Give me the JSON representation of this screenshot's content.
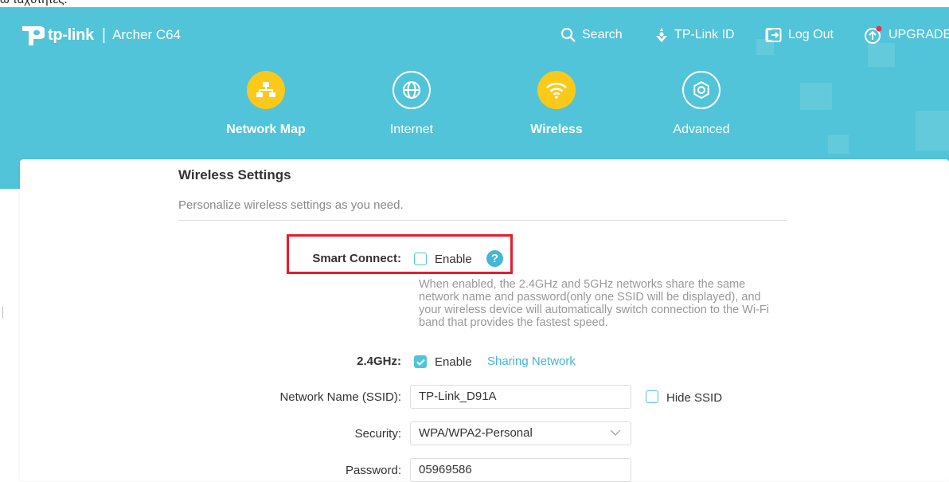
{
  "caption_text": "ώ ταχύτητες.",
  "brand": {
    "name": "tp-link",
    "model": "Archer C64"
  },
  "topnav": {
    "search": "Search",
    "tplink_id": "TP-Link ID",
    "logout": "Log Out",
    "upgrade": "UPGRADE"
  },
  "main_tabs": [
    {
      "label": "Network Map",
      "icon": "network-map-icon"
    },
    {
      "label": "Internet",
      "icon": "globe-icon"
    },
    {
      "label": "Wireless",
      "icon": "wifi-icon",
      "active": true
    },
    {
      "label": "Advanced",
      "icon": "advanced-gear-icon"
    }
  ],
  "page": {
    "title": "Wireless Settings",
    "subtitle": "Personalize wireless settings as you need."
  },
  "smart_connect": {
    "label": "Smart Connect:",
    "checkbox_label": "Enable",
    "checked": false,
    "help": "?",
    "description": "When enabled, the 2.4GHz and 5GHz networks share the same network name and password(only one SSID will be displayed), and your wireless device will automatically switch connection to the Wi-Fi band that provides the fastest speed."
  },
  "band_24": {
    "label": "2.4GHz:",
    "checkbox_label": "Enable",
    "checked": true,
    "sharing_link": "Sharing Network"
  },
  "ssid": {
    "label": "Network Name (SSID):",
    "value": "TP-Link_D91A",
    "hide_label": "Hide SSID",
    "hide_checked": false
  },
  "security": {
    "label": "Security:",
    "value": "WPA/WPA2-Personal"
  },
  "password": {
    "label": "Password:",
    "value": "05969586"
  },
  "colors": {
    "header": "#52c4d9",
    "accent": "#4ec5dd",
    "active_tab": "#fbc91a",
    "highlight": "#e41d2d"
  }
}
